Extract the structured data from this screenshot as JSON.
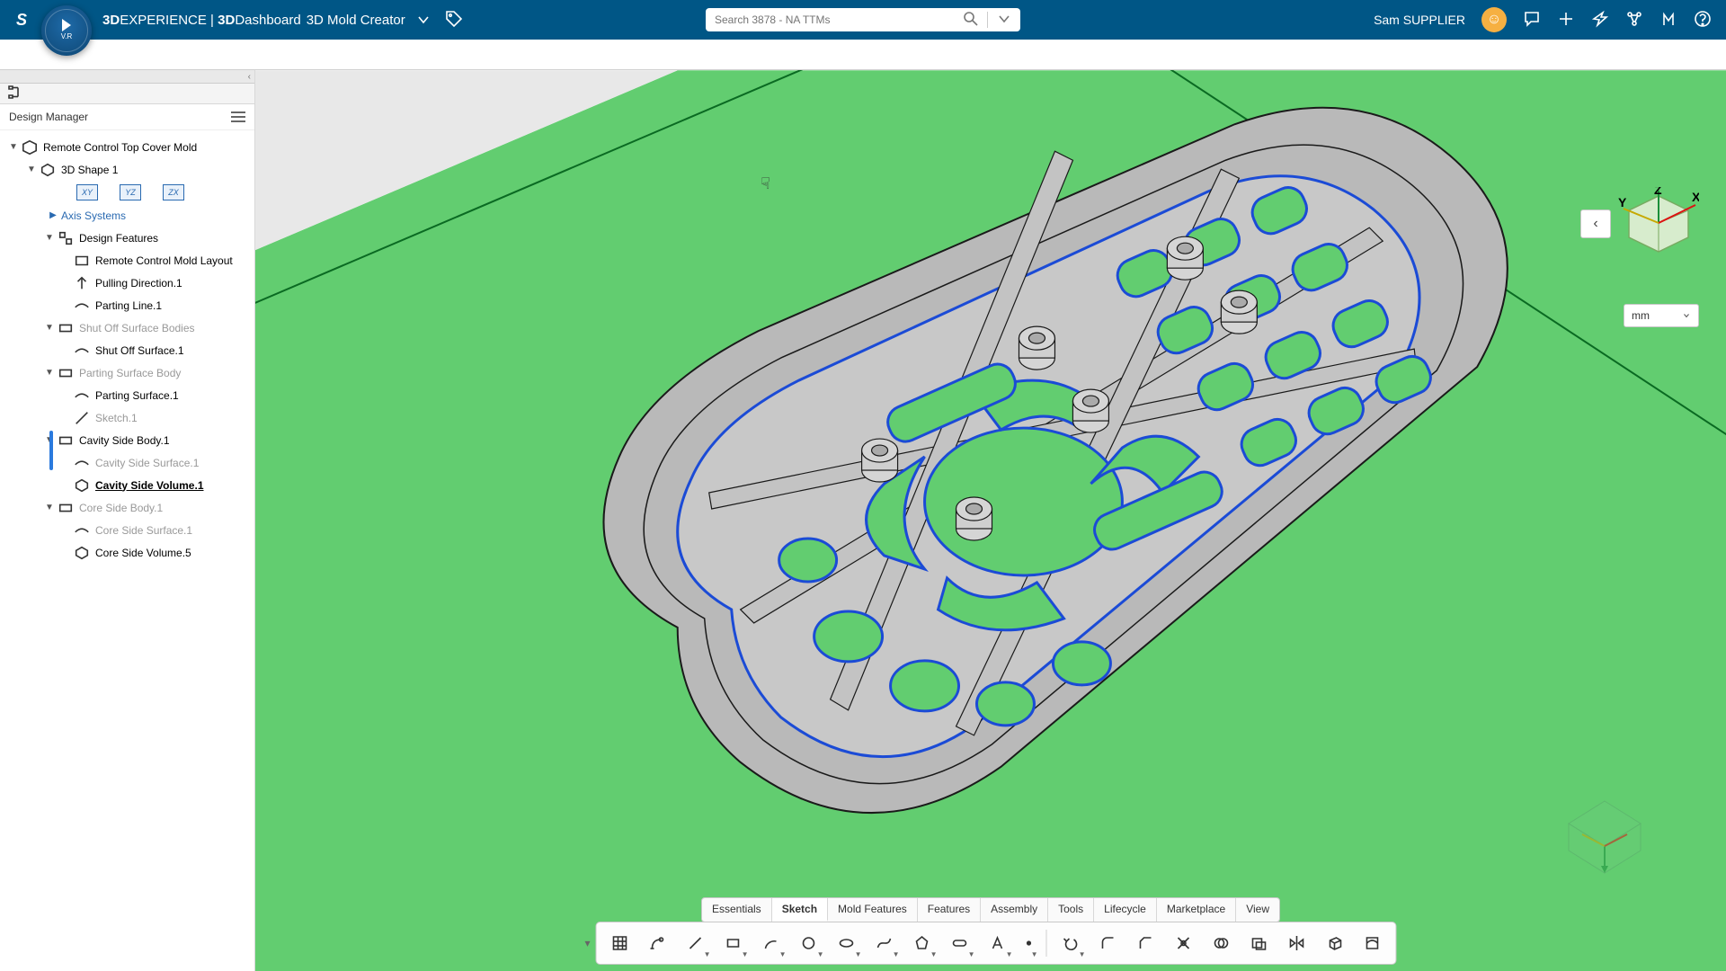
{
  "header": {
    "brand_prefix": "3D",
    "brand_main": "EXPERIENCE",
    "sep": " | ",
    "dash_prefix": "3D",
    "dash_main": "Dashboard",
    "app_name": "3D Mold Creator",
    "user_name": "Sam SUPPLIER"
  },
  "search": {
    "placeholder": "Search 3878 - NA TTMs"
  },
  "sidebar": {
    "title": "Design Manager",
    "root": "Remote Control Top Cover Mold",
    "shape": "3D Shape 1",
    "axis": "Axis Systems",
    "design_feat": "Design Features",
    "feat0": "Remote Control Mold Layout",
    "feat1": "Pulling Direction.1",
    "feat2": "Parting Line.1",
    "shutoff_grp": "Shut Off Surface Bodies",
    "shutoff1": "Shut Off Surface.1",
    "parting_grp": "Parting Surface Body",
    "parting1": "Parting Surface.1",
    "sketch1": "Sketch.1",
    "cavity_grp": "Cavity Side Body.1",
    "cavity_surf": "Cavity Side Surface.1",
    "cavity_vol": "Cavity Side Volume.1",
    "core_grp": "Core Side Body.1",
    "core_surf": "Core Side Surface.1",
    "core_vol": "Core Side Volume.5",
    "plane_xy": "XY",
    "plane_yz": "YZ",
    "plane_zx": "ZX"
  },
  "viewport": {
    "unit": "mm",
    "axes": {
      "x": "X",
      "y": "Y",
      "z": "Z"
    }
  },
  "tabs": {
    "items": [
      "Essentials",
      "Sketch",
      "Mold Features",
      "Features",
      "Assembly",
      "Tools",
      "Lifecycle",
      "Marketplace",
      "View"
    ],
    "active": 1
  },
  "toolbar": {
    "names": [
      "grid",
      "auto-constraint",
      "line",
      "rectangle",
      "arc",
      "circle",
      "ellipse",
      "spline",
      "polygon",
      "slot",
      "text",
      "point",
      "undo-arrow",
      "fillet",
      "chamfer",
      "trim",
      "intersect",
      "offset",
      "mirror-line",
      "box",
      "region"
    ]
  }
}
